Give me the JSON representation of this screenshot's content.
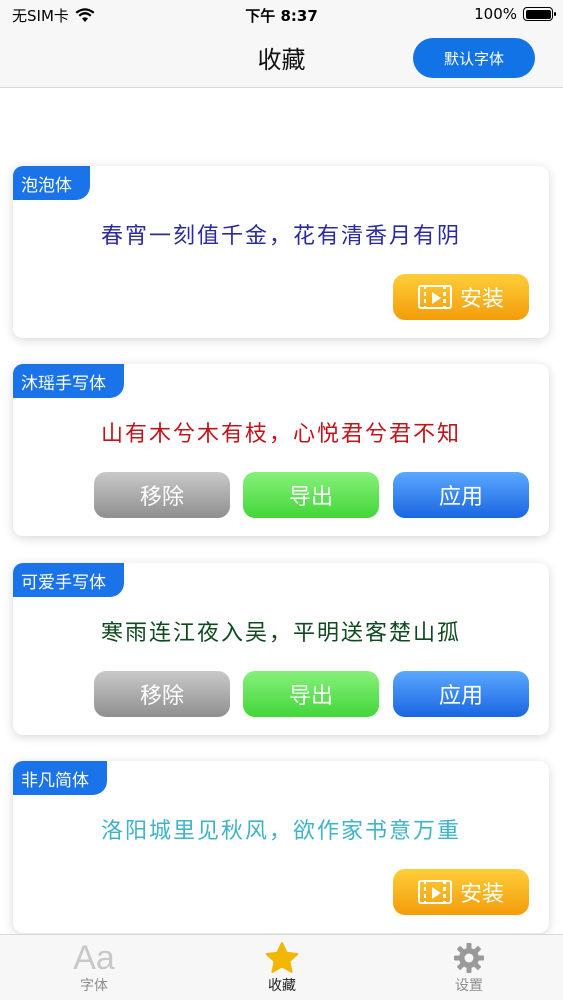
{
  "status_bar": {
    "carrier": "无SIM卡",
    "time": "下午 8:37",
    "battery": "100%"
  },
  "nav": {
    "title": "收藏",
    "default_font_button": "默认字体"
  },
  "cards": [
    {
      "name": "泡泡体",
      "sample": "春宵一刻值千金，花有清香月有阴",
      "sample_color": "#2a2aa0",
      "buttons": [
        "安装"
      ]
    },
    {
      "name": "沐瑶手写体",
      "sample": "山有木兮木有枝，心悦君兮君不知",
      "sample_color": "#c0141a",
      "buttons": [
        "移除",
        "导出",
        "应用"
      ]
    },
    {
      "name": "可爱手写体",
      "sample": "寒雨连江夜入吴，平明送客楚山孤",
      "sample_color": "#0f4a1f",
      "buttons": [
        "移除",
        "导出",
        "应用"
      ]
    },
    {
      "name": "非凡简体",
      "sample": "洛阳城里见秋风，欲作家书意万重",
      "sample_color": "#3fb3c7",
      "buttons": [
        "安装"
      ]
    }
  ],
  "tabs": [
    {
      "label": "字体",
      "icon": "font-aa-icon",
      "active": false
    },
    {
      "label": "收藏",
      "icon": "star-icon",
      "active": true
    },
    {
      "label": "设置",
      "icon": "gear-icon",
      "active": false
    }
  ],
  "colors": {
    "accent": "#1a73e8",
    "install": "#f7a823",
    "remove": "#a9a9a9",
    "export": "#5ddc52",
    "apply": "#3a86f0",
    "active_tab": "#f2b705"
  }
}
